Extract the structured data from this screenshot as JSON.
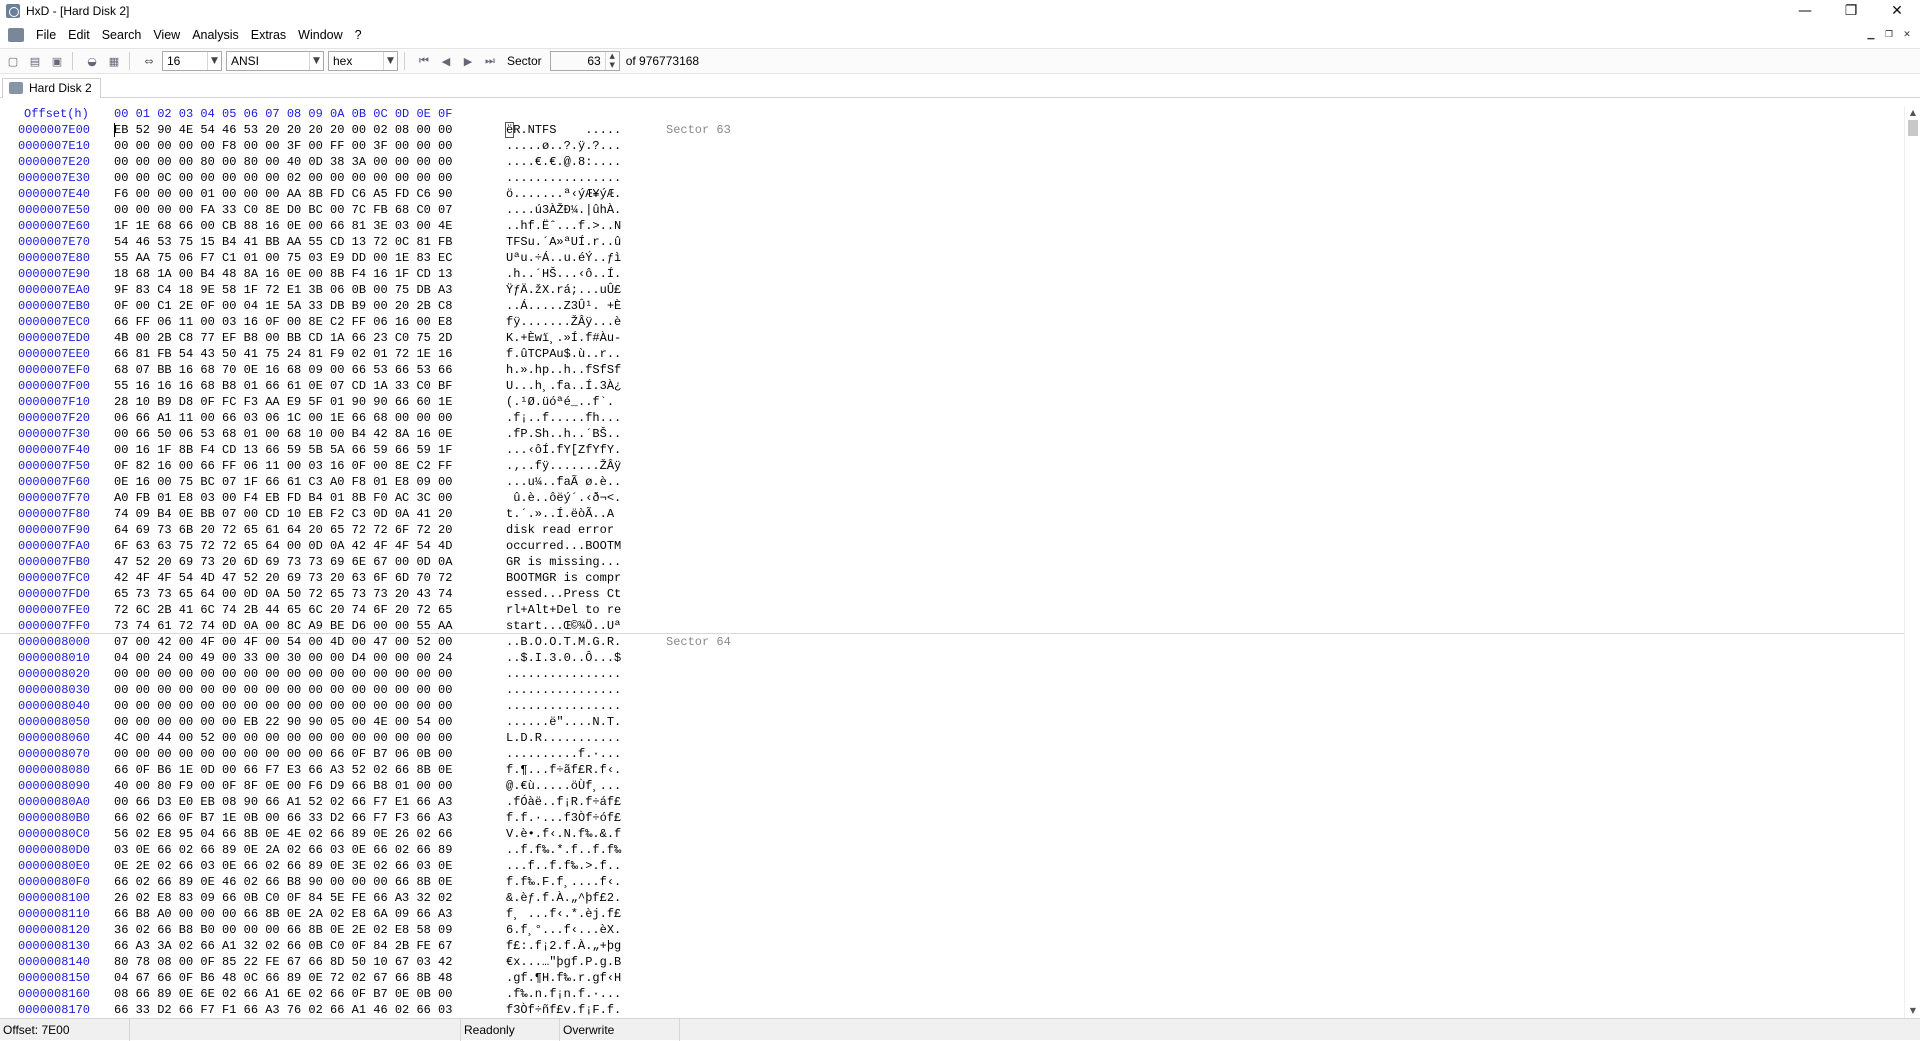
{
  "window": {
    "title": "HxD - [Hard Disk 2]"
  },
  "menu": [
    "File",
    "Edit",
    "Search",
    "View",
    "Analysis",
    "Extras",
    "Window",
    "?"
  ],
  "toolbar": {
    "bytes_per_row": "16",
    "charset": "ANSI",
    "offset_base": "hex",
    "sector_label": "Sector",
    "sector_value": "63",
    "sector_total": "of 976773168"
  },
  "tab": {
    "label": "Hard Disk 2"
  },
  "header": {
    "offset_label": "Offset(h)",
    "columns": "00 01 02 03 04 05 06 07 08 09 0A 0B 0C 0D 0E 0F"
  },
  "rows": [
    {
      "o": "0000007E00",
      "h": "EB 52 90 4E 54 46 53 20 20 20 20 00 02 08 00 00",
      "t": "ëR.NTFS    .....",
      "s": "Sector 63"
    },
    {
      "o": "0000007E10",
      "h": "00 00 00 00 00 F8 00 00 3F 00 FF 00 3F 00 00 00",
      "t": ".....ø..?.ÿ.?..."
    },
    {
      "o": "0000007E20",
      "h": "00 00 00 00 80 00 80 00 40 0D 38 3A 00 00 00 00",
      "t": "....€.€.@.8:...."
    },
    {
      "o": "0000007E30",
      "h": "00 00 0C 00 00 00 00 00 02 00 00 00 00 00 00 00",
      "t": "................"
    },
    {
      "o": "0000007E40",
      "h": "F6 00 00 00 01 00 00 00 AA 8B FD C6 A5 FD C6 90",
      "t": "ö.......ª‹ýÆ¥ýÆ."
    },
    {
      "o": "0000007E50",
      "h": "00 00 00 00 FA 33 C0 8E D0 BC 00 7C FB 68 C0 07",
      "t": "....ú3ÀŽÐ¼.|ûhÀ."
    },
    {
      "o": "0000007E60",
      "h": "1F 1E 68 66 00 CB 88 16 0E 00 66 81 3E 03 00 4E",
      "t": "..hf.Ëˆ...f.>..N"
    },
    {
      "o": "0000007E70",
      "h": "54 46 53 75 15 B4 41 BB AA 55 CD 13 72 0C 81 FB",
      "t": "TFSu.´A»ªUÍ.r..û"
    },
    {
      "o": "0000007E80",
      "h": "55 AA 75 06 F7 C1 01 00 75 03 E9 DD 00 1E 83 EC",
      "t": "Uªu.÷Á..u.éÝ..ƒì"
    },
    {
      "o": "0000007E90",
      "h": "18 68 1A 00 B4 48 8A 16 0E 00 8B F4 16 1F CD 13",
      "t": ".h..´HŠ...‹ô..Í."
    },
    {
      "o": "0000007EA0",
      "h": "9F 83 C4 18 9E 58 1F 72 E1 3B 06 0B 00 75 DB A3",
      "t": "ŸƒÄ.žX.rá;...uÛ£"
    },
    {
      "o": "0000007EB0",
      "h": "0F 00 C1 2E 0F 00 04 1E 5A 33 DB B9 00 20 2B C8",
      "t": "..Á.....Z3Û¹. +È"
    },
    {
      "o": "0000007EC0",
      "h": "66 FF 06 11 00 03 16 0F 00 8E C2 FF 06 16 00 E8",
      "t": "fÿ.......ŽÂÿ...è"
    },
    {
      "o": "0000007ED0",
      "h": "4B 00 2B C8 77 EF B8 00 BB CD 1A 66 23 C0 75 2D",
      "t": "K.+Èwï¸.»Í.f#Àu-"
    },
    {
      "o": "0000007EE0",
      "h": "66 81 FB 54 43 50 41 75 24 81 F9 02 01 72 1E 16",
      "t": "f.ûTCPAu$.ù..r.."
    },
    {
      "o": "0000007EF0",
      "h": "68 07 BB 16 68 70 0E 16 68 09 00 66 53 66 53 66",
      "t": "h.».hp..h..fSfSf"
    },
    {
      "o": "0000007F00",
      "h": "55 16 16 16 68 B8 01 66 61 0E 07 CD 1A 33 C0 BF",
      "t": "U...h¸.fa..Í.3À¿"
    },
    {
      "o": "0000007F10",
      "h": "28 10 B9 D8 0F FC F3 AA E9 5F 01 90 90 66 60 1E",
      "t": "(.¹Ø.üóªé_..f`."
    },
    {
      "o": "0000007F20",
      "h": "06 66 A1 11 00 66 03 06 1C 00 1E 66 68 00 00 00",
      "t": ".f¡..f.....fh..."
    },
    {
      "o": "0000007F30",
      "h": "00 66 50 06 53 68 01 00 68 10 00 B4 42 8A 16 0E",
      "t": ".fP.Sh..h..´BŠ.."
    },
    {
      "o": "0000007F40",
      "h": "00 16 1F 8B F4 CD 13 66 59 5B 5A 66 59 66 59 1F",
      "t": "...‹ôÍ.fY[ZfYfY."
    },
    {
      "o": "0000007F50",
      "h": "0F 82 16 00 66 FF 06 11 00 03 16 0F 00 8E C2 FF",
      "t": ".‚..fÿ.......ŽÂÿ"
    },
    {
      "o": "0000007F60",
      "h": "0E 16 00 75 BC 07 1F 66 61 C3 A0 F8 01 E8 09 00",
      "t": "...u¼..faÃ ø.è.."
    },
    {
      "o": "0000007F70",
      "h": "A0 FB 01 E8 03 00 F4 EB FD B4 01 8B F0 AC 3C 00",
      "t": " û.è..ôëý´.‹ð¬<."
    },
    {
      "o": "0000007F80",
      "h": "74 09 B4 0E BB 07 00 CD 10 EB F2 C3 0D 0A 41 20",
      "t": "t.´.»..Í.ëòÃ..A "
    },
    {
      "o": "0000007F90",
      "h": "64 69 73 6B 20 72 65 61 64 20 65 72 72 6F 72 20",
      "t": "disk read error "
    },
    {
      "o": "0000007FA0",
      "h": "6F 63 63 75 72 72 65 64 00 0D 0A 42 4F 4F 54 4D",
      "t": "occurred...BOOTM"
    },
    {
      "o": "0000007FB0",
      "h": "47 52 20 69 73 20 6D 69 73 73 69 6E 67 00 0D 0A",
      "t": "GR is missing..."
    },
    {
      "o": "0000007FC0",
      "h": "42 4F 4F 54 4D 47 52 20 69 73 20 63 6F 6D 70 72",
      "t": "BOOTMGR is compr"
    },
    {
      "o": "0000007FD0",
      "h": "65 73 73 65 64 00 0D 0A 50 72 65 73 73 20 43 74",
      "t": "essed...Press Ct"
    },
    {
      "o": "0000007FE0",
      "h": "72 6C 2B 41 6C 74 2B 44 65 6C 20 74 6F 20 72 65",
      "t": "rl+Alt+Del to re"
    },
    {
      "o": "0000007FF0",
      "h": "73 74 61 72 74 0D 0A 00 8C A9 BE D6 00 00 55 AA",
      "t": "start...Œ©¾Ö..Uª"
    },
    {
      "o": "0000008000",
      "h": "07 00 42 00 4F 00 4F 00 54 00 4D 00 47 00 52 00",
      "t": "..B.O.O.T.M.G.R.",
      "s": "Sector 64"
    },
    {
      "o": "0000008010",
      "h": "04 00 24 00 49 00 33 00 30 00 00 D4 00 00 00 24",
      "t": "..$.I.3.0..Ô...$"
    },
    {
      "o": "0000008020",
      "h": "00 00 00 00 00 00 00 00 00 00 00 00 00 00 00 00",
      "t": "................"
    },
    {
      "o": "0000008030",
      "h": "00 00 00 00 00 00 00 00 00 00 00 00 00 00 00 00",
      "t": "................"
    },
    {
      "o": "0000008040",
      "h": "00 00 00 00 00 00 00 00 00 00 00 00 00 00 00 00",
      "t": "................"
    },
    {
      "o": "0000008050",
      "h": "00 00 00 00 00 00 EB 22 90 90 05 00 4E 00 54 00",
      "t": "......ë\"....N.T."
    },
    {
      "o": "0000008060",
      "h": "4C 00 44 00 52 00 00 00 00 00 00 00 00 00 00 00",
      "t": "L.D.R..........."
    },
    {
      "o": "0000008070",
      "h": "00 00 00 00 00 00 00 00 00 00 66 0F B7 06 0B 00",
      "t": "..........f.·..."
    },
    {
      "o": "0000008080",
      "h": "66 0F B6 1E 0D 00 66 F7 E3 66 A3 52 02 66 8B 0E",
      "t": "f.¶...f÷ãf£R.f‹."
    },
    {
      "o": "0000008090",
      "h": "40 00 80 F9 00 0F 8F 0E 00 F6 D9 66 B8 01 00 00",
      "t": "@.€ù.....öÙf¸..."
    },
    {
      "o": "00000080A0",
      "h": "00 66 D3 E0 EB 08 90 66 A1 52 02 66 F7 E1 66 A3",
      "t": ".fÓàë..f¡R.f÷áf£"
    },
    {
      "o": "00000080B0",
      "h": "66 02 66 0F B7 1E 0B 00 66 33 D2 66 F7 F3 66 A3",
      "t": "f.f.·...f3Òf÷óf£"
    },
    {
      "o": "00000080C0",
      "h": "56 02 E8 95 04 66 8B 0E 4E 02 66 89 0E 26 02 66",
      "t": "V.è•.f‹.N.f‰.&.f"
    },
    {
      "o": "00000080D0",
      "h": "03 0E 66 02 66 89 0E 2A 02 66 03 0E 66 02 66 89",
      "t": "..f.f‰.*.f..f.f‰"
    },
    {
      "o": "00000080E0",
      "h": "0E 2E 02 66 03 0E 66 02 66 89 0E 3E 02 66 03 0E",
      "t": "...f..f.f‰.>.f.."
    },
    {
      "o": "00000080F0",
      "h": "66 02 66 89 0E 46 02 66 B8 90 00 00 00 66 8B 0E",
      "t": "f.f‰.F.f¸....f‹."
    },
    {
      "o": "0000008100",
      "h": "26 02 E8 83 09 66 0B C0 0F 84 5E FE 66 A3 32 02",
      "t": "&.èƒ.f.À.„^þf£2."
    },
    {
      "o": "0000008110",
      "h": "66 B8 A0 00 00 00 66 8B 0E 2A 02 E8 6A 09 66 A3",
      "t": "f¸ ...f‹.*.èj.f£"
    },
    {
      "o": "0000008120",
      "h": "36 02 66 B8 B0 00 00 00 66 8B 0E 2E 02 E8 58 09",
      "t": "6.f¸°...f‹...èX."
    },
    {
      "o": "0000008130",
      "h": "66 A3 3A 02 66 A1 32 02 66 0B C0 0F 84 2B FE 67",
      "t": "f£:.f¡2.f.À.„+þg"
    },
    {
      "o": "0000008140",
      "h": "80 78 08 00 0F 85 22 FE 67 66 8D 50 10 67 03 42",
      "t": "€x...…\"þgf.P.g.B"
    },
    {
      "o": "0000008150",
      "h": "04 67 66 0F B6 48 0C 66 89 0E 72 02 67 66 8B 48",
      "t": ".gf.¶H.f‰.r.gf‹H"
    },
    {
      "o": "0000008160",
      "h": "08 66 89 0E 6E 02 66 A1 6E 02 66 0F B7 0E 0B 00",
      "t": ".f‰.n.f¡n.f.·..."
    },
    {
      "o": "0000008170",
      "h": "66 33 D2 66 F7 F1 66 A3 76 02 66 A1 46 02 66 03",
      "t": "f3Òf÷ñf£v.f¡F.f."
    }
  ],
  "status": {
    "offset": "Offset: 7E00",
    "mode": "Readonly",
    "insert": "Overwrite"
  }
}
